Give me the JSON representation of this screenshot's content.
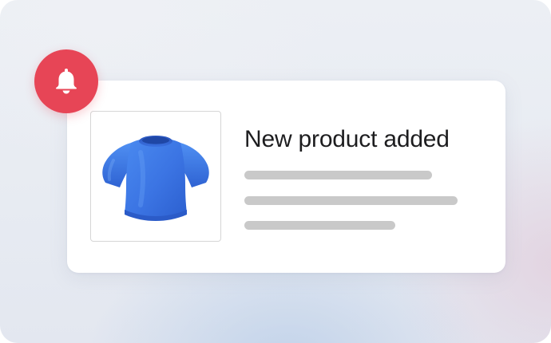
{
  "notification": {
    "title": "New product added",
    "product_image": "blue-tshirt",
    "icon": "bell-icon",
    "badge_color": "#e74556",
    "product_color": "#3f7be6"
  }
}
